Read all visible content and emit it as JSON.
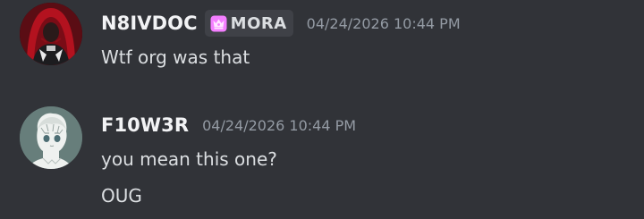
{
  "messages": [
    {
      "author": {
        "username": "N8IVDOC",
        "server_tag": {
          "icon": "crown-tag-icon",
          "label": "MORA"
        },
        "avatar": "avatar-red-hood"
      },
      "timestamp": "04/24/2026 10:44 PM",
      "lines": [
        "Wtf org was that"
      ]
    },
    {
      "author": {
        "username": "F10W3R",
        "avatar": "avatar-anime-sketch"
      },
      "timestamp": "04/24/2026 10:44 PM",
      "lines": [
        "you mean this one?",
        "OUG"
      ]
    }
  ],
  "colors": {
    "background": "#313338",
    "username": "#f2f3f5",
    "text": "#dbdee1",
    "timestamp": "#949ba4",
    "tag_background": "#3f4147",
    "tag_icon": "#f47fff"
  }
}
